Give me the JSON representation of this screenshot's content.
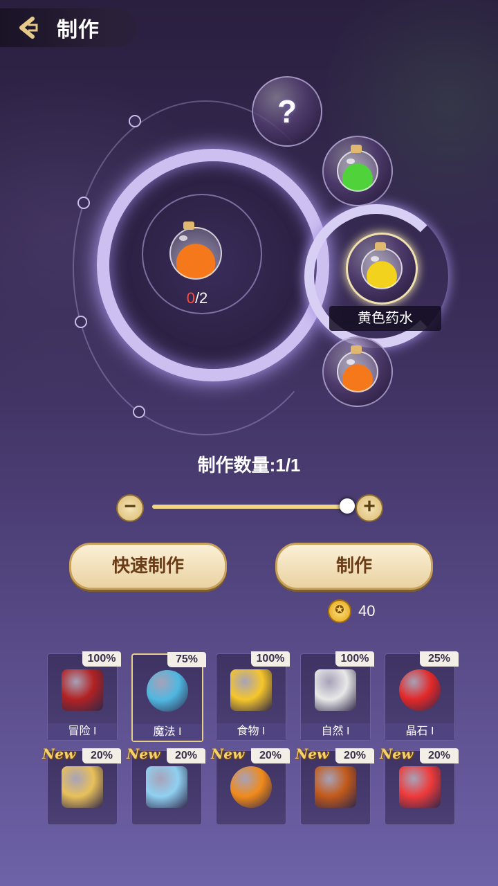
{
  "header": {
    "title": "制作",
    "back_icon": "chevron-left-icon"
  },
  "recipe": {
    "selected_name": "黄色药水",
    "progress_current": "0",
    "progress_total": "/2",
    "unknown_slot": "?",
    "center_potion_color": "#f5781a",
    "options": [
      {
        "name": "green-potion",
        "color": "#4fd23a"
      },
      {
        "name": "yellow-potion",
        "color": "#f2d21c"
      },
      {
        "name": "orange-potion",
        "color": "#f5781a"
      }
    ]
  },
  "quantity": {
    "label": "制作数量:1/1",
    "minus": "−",
    "plus": "+",
    "fill": 1.0
  },
  "actions": {
    "quick_craft": "快速制作",
    "craft": "制作",
    "cost": "40",
    "coin_glyph": "✪"
  },
  "categories": [
    {
      "label": "冒险 I",
      "percent": "100%",
      "icon": "red-book-icon",
      "color": "#b22222",
      "selected": false
    },
    {
      "label": "魔法 I",
      "percent": "75%",
      "icon": "blue-potion-icon",
      "color": "#4fb7e0",
      "selected": true
    },
    {
      "label": "食物 I",
      "percent": "100%",
      "icon": "cheese-icon",
      "color": "#f5c62a",
      "selected": false
    },
    {
      "label": "自然 I",
      "percent": "100%",
      "icon": "stone-icon",
      "color": "#e8e8e8",
      "selected": false
    },
    {
      "label": "晶石 I",
      "percent": "25%",
      "icon": "red-orb-icon",
      "color": "#e22828",
      "selected": false
    }
  ],
  "new_items": [
    {
      "badge": "New",
      "percent": "20%",
      "icon": "scroll-icon",
      "color": "#e8c05a"
    },
    {
      "badge": "New",
      "percent": "20%",
      "icon": "blue-cloth-icon",
      "color": "#8fd0f0"
    },
    {
      "badge": "New",
      "percent": "20%",
      "icon": "pumpkin-icon",
      "color": "#f08a1a"
    },
    {
      "badge": "New",
      "percent": "20%",
      "icon": "lava-plank-icon",
      "color": "#c25a1a"
    },
    {
      "badge": "New",
      "percent": "20%",
      "icon": "red-gem-icon",
      "color": "#ef3a3a"
    }
  ]
}
